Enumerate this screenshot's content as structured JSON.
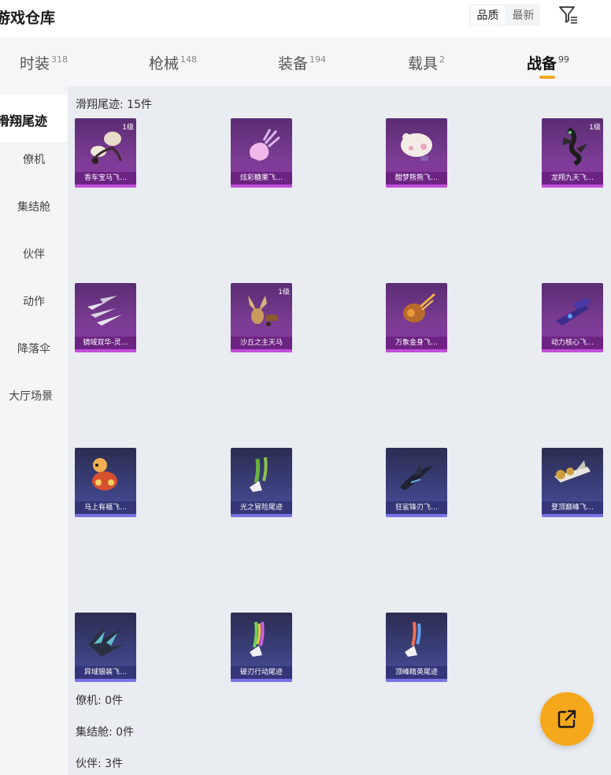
{
  "header": {
    "title": "游戏仓库",
    "sort_quality": "品质",
    "sort_latest": "最新"
  },
  "tabs": [
    {
      "label": "时装",
      "count": "318"
    },
    {
      "label": "枪械",
      "count": "148"
    },
    {
      "label": "装备",
      "count": "194"
    },
    {
      "label": "载具",
      "count": "2"
    },
    {
      "label": "战备",
      "count": "99"
    }
  ],
  "sidebar": [
    "滑翔尾迹",
    "僚机",
    "集结舱",
    "伙伴",
    "动作",
    "降落伞",
    "大厅场景"
  ],
  "sections": {
    "glide": "滑翔尾迹: 15件",
    "wingman": "僚机: 0件",
    "pod": "集结舱: 0件",
    "partner": "伙伴: 3件"
  },
  "items": [
    {
      "name": "香车宝马飞…",
      "level": "1级",
      "rarity": "purple",
      "icon": "carriage-horse-icon"
    },
    {
      "name": "炫彩糖果飞…",
      "level": "",
      "rarity": "purple",
      "icon": "candy-icon"
    },
    {
      "name": "酣梦熊熊飞…",
      "level": "",
      "rarity": "purple",
      "icon": "bear-icon"
    },
    {
      "name": "龙翔九天飞…",
      "level": "1级",
      "rarity": "purple",
      "icon": "dragon-icon"
    },
    {
      "name": "镜域双华-灵…",
      "level": "",
      "rarity": "purple",
      "icon": "mirror-blades-icon"
    },
    {
      "name": "沙丘之主天马",
      "level": "1级",
      "rarity": "purple",
      "icon": "pegasus-icon"
    },
    {
      "name": "万象金身飞…",
      "level": "",
      "rarity": "purple",
      "icon": "golden-comet-icon"
    },
    {
      "name": "动力核心飞…",
      "level": "",
      "rarity": "purple",
      "icon": "power-core-icon"
    },
    {
      "name": "马上有福飞…",
      "level": "",
      "rarity": "blue",
      "icon": "toy-horse-icon"
    },
    {
      "name": "光之冒险尾迹",
      "level": "",
      "rarity": "blue",
      "icon": "trail-green-icon"
    },
    {
      "name": "狂鲨锋刃飞…",
      "level": "",
      "rarity": "blue",
      "icon": "shark-icon"
    },
    {
      "name": "登顶巅峰飞…",
      "level": "",
      "rarity": "blue",
      "icon": "jet-icon"
    },
    {
      "name": "异域银装飞…",
      "level": "",
      "rarity": "blue",
      "icon": "silver-wings-icon"
    },
    {
      "name": "破刃行动尾迹",
      "level": "",
      "rarity": "blue",
      "icon": "trail-rainbow-icon"
    },
    {
      "name": "顶峰精英尾迹",
      "level": "",
      "rarity": "blue",
      "icon": "trail-blue-icon"
    }
  ],
  "colors": {
    "accent": "#f2a822",
    "fab": "#f5a81b",
    "purple_card": "#7a3b92",
    "blue_card": "#3a3f7a"
  }
}
